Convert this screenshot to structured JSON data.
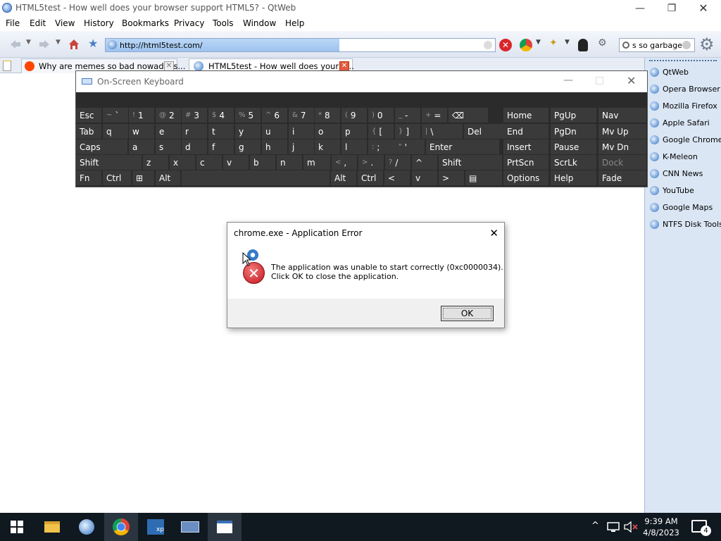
{
  "window": {
    "title": "HTML5test - How well does your browser support HTML5? - QtWeb"
  },
  "menu": [
    "File",
    "Edit",
    "View",
    "History",
    "Bookmarks",
    "Privacy",
    "Tools",
    "Window",
    "Help"
  ],
  "toolbar": {
    "url": "http://html5test.com/",
    "load_progress": 0.6,
    "search_value": "s so garbage"
  },
  "tabs": [
    {
      "label": "Why are memes so bad nowadays..."
    },
    {
      "label": "HTML5test - How well does your b..."
    }
  ],
  "bookmarks": [
    "QtWeb",
    "Opera Browser",
    "Mozilla Firefox",
    "Apple Safari",
    "Google Chrome",
    "K-Meleon",
    "CNN News",
    "YouTube",
    "Google Maps",
    "NTFS Disk Tools"
  ],
  "osk": {
    "title": "On-Screen Keyboard",
    "rows": [
      [
        {
          "k": "Esc"
        },
        {
          "s": "~",
          "k": "`"
        },
        {
          "s": "!",
          "k": "1"
        },
        {
          "s": "@",
          "k": "2"
        },
        {
          "s": "#",
          "k": "3"
        },
        {
          "s": "$",
          "k": "4"
        },
        {
          "s": "%",
          "k": "5"
        },
        {
          "s": "^",
          "k": "6"
        },
        {
          "s": "&",
          "k": "7"
        },
        {
          "s": "*",
          "k": "8"
        },
        {
          "s": "(",
          "k": "9"
        },
        {
          "s": ")",
          "k": "0"
        },
        {
          "s": "_",
          "k": "-"
        },
        {
          "s": "+",
          "k": "="
        },
        {
          "k": "⌫"
        }
      ],
      [
        {
          "k": "Tab"
        },
        {
          "k": "q"
        },
        {
          "k": "w"
        },
        {
          "k": "e"
        },
        {
          "k": "r"
        },
        {
          "k": "t"
        },
        {
          "k": "y"
        },
        {
          "k": "u"
        },
        {
          "k": "i"
        },
        {
          "k": "o"
        },
        {
          "k": "p"
        },
        {
          "s": "{",
          "k": "["
        },
        {
          "s": "}",
          "k": "]"
        },
        {
          "s": "|",
          "k": "\\"
        },
        {
          "k": "Del"
        }
      ],
      [
        {
          "k": "Caps"
        },
        {
          "k": "a"
        },
        {
          "k": "s"
        },
        {
          "k": "d"
        },
        {
          "k": "f"
        },
        {
          "k": "g"
        },
        {
          "k": "h"
        },
        {
          "k": "j"
        },
        {
          "k": "k"
        },
        {
          "k": "l"
        },
        {
          "s": ":",
          "k": ";"
        },
        {
          "s": "\"",
          "k": "'"
        },
        {
          "k": "Enter"
        }
      ],
      [
        {
          "k": "Shift"
        },
        {
          "k": "z"
        },
        {
          "k": "x"
        },
        {
          "k": "c"
        },
        {
          "k": "v"
        },
        {
          "k": "b"
        },
        {
          "k": "n"
        },
        {
          "k": "m"
        },
        {
          "s": "<",
          "k": ","
        },
        {
          "s": ">",
          "k": "."
        },
        {
          "s": "?",
          "k": "/"
        },
        {
          "k": "^"
        },
        {
          "k": "Shift"
        }
      ],
      [
        {
          "k": "Fn"
        },
        {
          "k": "Ctrl"
        },
        {
          "k": "⊞"
        },
        {
          "k": "Alt"
        },
        {
          "k": ""
        },
        {
          "k": "Alt"
        },
        {
          "k": "Ctrl"
        },
        {
          "k": "<"
        },
        {
          "k": "v"
        },
        {
          "k": ">"
        },
        {
          "k": "▤"
        }
      ]
    ],
    "nav": [
      [
        "Home",
        "PgUp",
        "Nav"
      ],
      [
        "End",
        "PgDn",
        "Mv Up"
      ],
      [
        "Insert",
        "Pause",
        "Mv Dn"
      ],
      [
        "PrtScn",
        "ScrLk",
        "Dock"
      ],
      [
        "Options",
        "Help",
        "Fade"
      ]
    ]
  },
  "dialog": {
    "title": "chrome.exe - Application Error",
    "line1": "The application was unable to start correctly (0xc0000034).",
    "line2": "Click OK to close the application.",
    "ok_label": "OK"
  },
  "taskbar": {
    "time": "9:39 AM",
    "date": "4/8/2023",
    "notifications": "4"
  }
}
